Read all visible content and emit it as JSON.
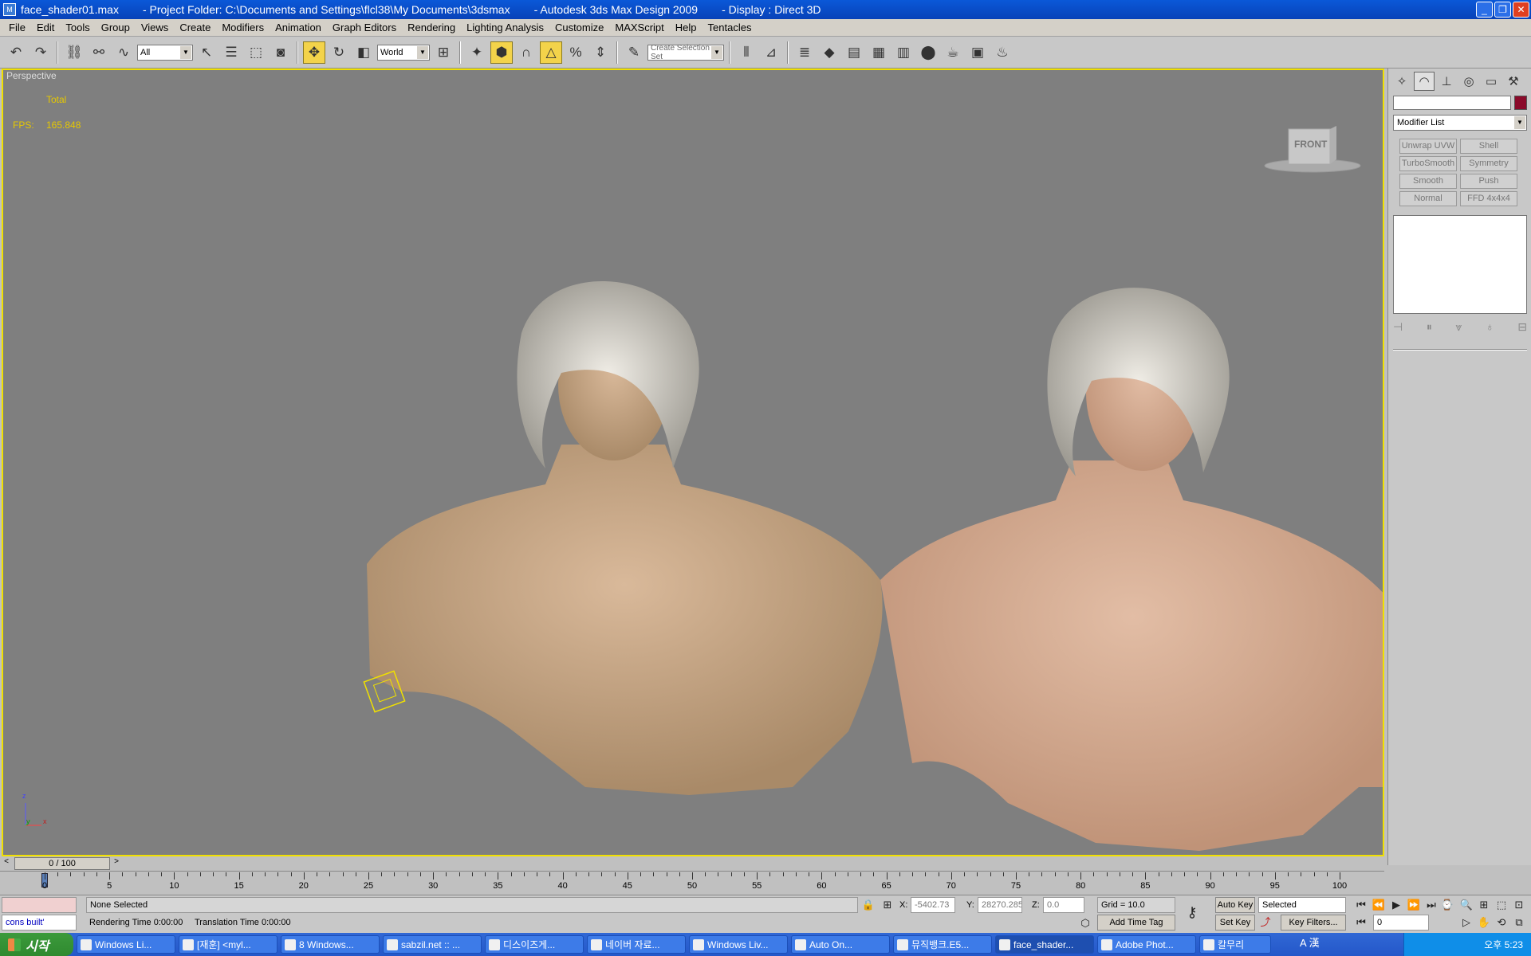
{
  "window": {
    "file": "face_shader01.max",
    "project_folder": "- Project Folder: C:\\Documents and Settings\\flcl38\\My Documents\\3dsmax",
    "app": "- Autodesk 3ds Max Design 2009",
    "display": "- Display : Direct 3D",
    "minimize_label": "_",
    "maximize_label": "❐",
    "close_label": "✕"
  },
  "menu": [
    "File",
    "Edit",
    "Tools",
    "Group",
    "Views",
    "Create",
    "Modifiers",
    "Animation",
    "Graph Editors",
    "Rendering",
    "Lighting Analysis",
    "Customize",
    "MAXScript",
    "Help",
    "Tentacles"
  ],
  "toolbar": {
    "filter_value": "All",
    "coord_system": "World",
    "selection_set_placeholder": "Create Selection Set"
  },
  "viewport": {
    "label": "Perspective",
    "stats_total": "Total",
    "fps_label": "FPS:",
    "fps_value": "165.848",
    "viewcube_face": "FRONT",
    "axis_z": "z",
    "axis_y": "y",
    "axis_x": "x"
  },
  "command_panel": {
    "modifier_list": "Modifier List",
    "modifier_buttons": [
      "Unwrap UVW",
      "Shell",
      "TurboSmooth",
      "Symmetry",
      "Smooth",
      "Push",
      "Normal",
      "FFD 4x4x4"
    ],
    "color_swatch": "#8a0a2a"
  },
  "timeline": {
    "frame_display": "0 / 100",
    "current_frame": 0,
    "total_frames": 100,
    "tick_labels": [
      "0",
      "5",
      "10",
      "15",
      "20",
      "25",
      "30",
      "35",
      "40",
      "45",
      "50",
      "55",
      "60",
      "65",
      "70",
      "75",
      "80",
      "85",
      "90",
      "95",
      "100"
    ]
  },
  "status": {
    "maxscript_listener": "cons built'",
    "selection_status": "None Selected",
    "rendering_time": "Rendering Time  0:00:00",
    "translation_time": "Translation Time  0:00:00",
    "x_label": "X:",
    "x_value": "-5402.73",
    "y_label": "Y:",
    "y_value": "28270.285",
    "z_label": "Z:",
    "z_value": "0.0",
    "grid": "Grid = 10.0",
    "add_time_tag": "Add Time Tag",
    "auto_key": "Auto Key",
    "set_key": "Set Key",
    "key_mode": "Selected",
    "key_filters": "Key Filters...",
    "frame_field": "0"
  },
  "taskbar": {
    "start_label": "시작",
    "tasks": [
      "Windows Li...",
      "[재훈] <myl...",
      "8 Windows...",
      "sabzil.net :: ...",
      "디스이즈게...",
      "네이버 자료...",
      "Windows Liv...",
      "Auto On...",
      "뮤직뱅크.E5...",
      "face_shader...",
      "Adobe Phot...",
      "칼무리"
    ],
    "active_task_index": 9,
    "clock": "오후 5:23",
    "ime": "A 漢"
  }
}
